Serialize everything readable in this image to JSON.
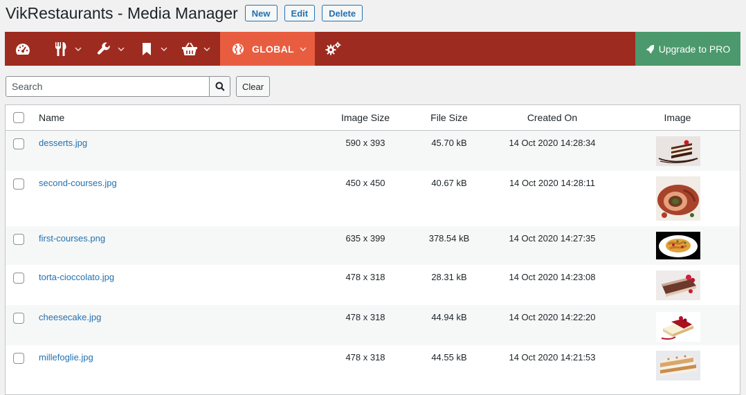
{
  "header": {
    "title": "VikRestaurants - Media Manager",
    "buttons": {
      "new": "New",
      "edit": "Edit",
      "delete": "Delete"
    }
  },
  "menu": {
    "items": [
      {
        "icon": "dashboard-icon"
      },
      {
        "icon": "restaurant-icon"
      },
      {
        "icon": "wrench-icon"
      },
      {
        "icon": "bookmark-icon"
      },
      {
        "icon": "basket-icon"
      },
      {
        "icon": "globe-icon",
        "label": "GLOBAL",
        "active": true
      },
      {
        "icon": "gears-icon"
      }
    ],
    "upgrade_label": "Upgrade to PRO",
    "colors": {
      "bar": "#9e2b1f",
      "active": "#e85d40",
      "upgrade": "#4b996c"
    }
  },
  "search": {
    "placeholder": "Search",
    "value": "",
    "clear_label": "Clear"
  },
  "table": {
    "columns": {
      "name": "Name",
      "image_size": "Image Size",
      "file_size": "File Size",
      "created_on": "Created On",
      "image": "Image"
    },
    "rows": [
      {
        "name": "desserts.jpg",
        "image_size": "590 x 393",
        "file_size": "45.70 kB",
        "created_on": "14 Oct 2020 14:28:34",
        "thumb": "cake-slice"
      },
      {
        "name": "second-courses.jpg",
        "image_size": "450 x 450",
        "file_size": "40.67 kB",
        "created_on": "14 Oct 2020 14:28:11",
        "thumb": "meat-roll"
      },
      {
        "name": "first-courses.png",
        "image_size": "635 x 399",
        "file_size": "378.54 kB",
        "created_on": "14 Oct 2020 14:27:35",
        "thumb": "pasta"
      },
      {
        "name": "torta-cioccolato.jpg",
        "image_size": "478 x 318",
        "file_size": "28.31 kB",
        "created_on": "14 Oct 2020 14:23:08",
        "thumb": "chocolate-cake"
      },
      {
        "name": "cheesecake.jpg",
        "image_size": "478 x 318",
        "file_size": "44.94 kB",
        "created_on": "14 Oct 2020 14:22:20",
        "thumb": "cheesecake"
      },
      {
        "name": "millefoglie.jpg",
        "image_size": "478 x 318",
        "file_size": "44.55 kB",
        "created_on": "14 Oct 2020 14:21:53",
        "thumb": "millefoglie"
      }
    ]
  }
}
